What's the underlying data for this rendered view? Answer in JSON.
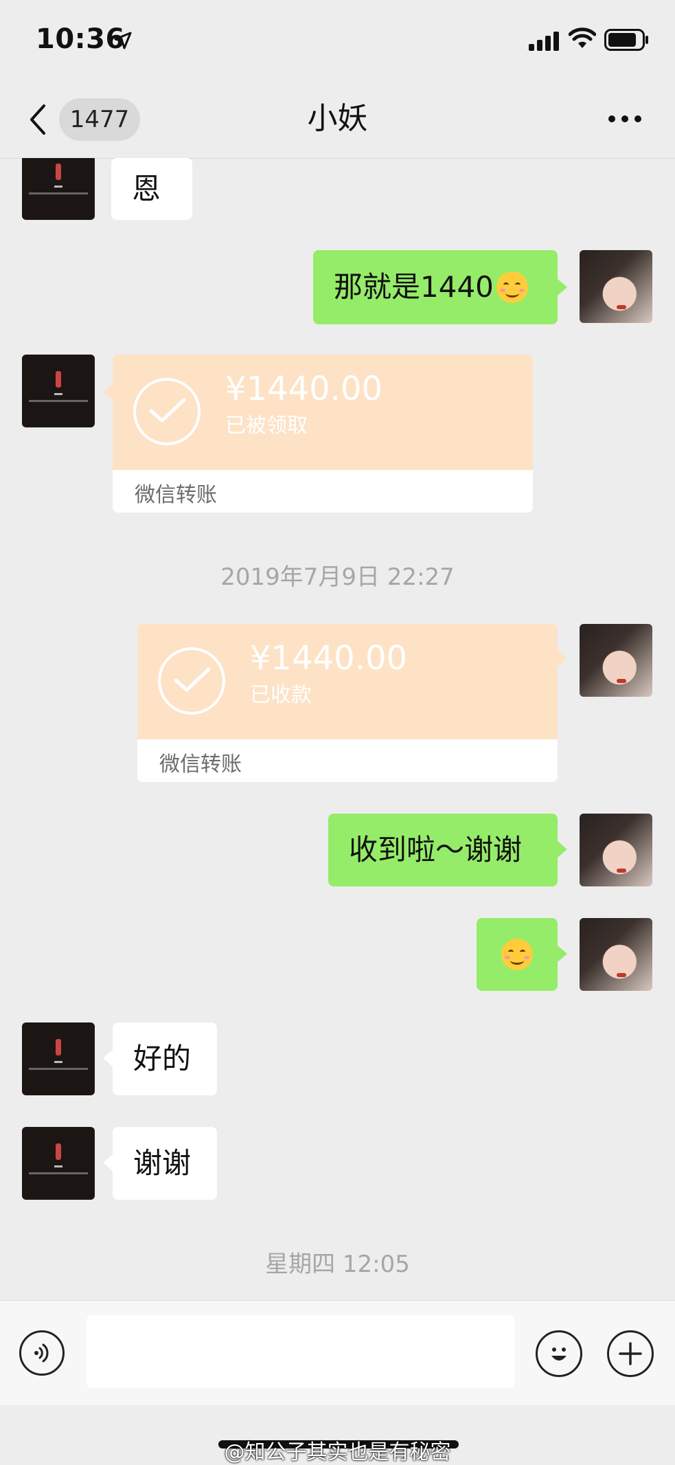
{
  "status_bar": {
    "time": "10:36"
  },
  "header": {
    "back_count": "1477",
    "title": "小妖"
  },
  "messages": [
    {
      "text": "恩"
    },
    {
      "text": "那就是1440"
    },
    {
      "amount": "¥1440.00",
      "status": "已被领取",
      "label": "微信转账"
    },
    {
      "amount": "¥1440.00",
      "status": "已收款",
      "label": "微信转账"
    },
    {
      "text": "收到啦～谢谢"
    },
    {
      "text": "好的"
    },
    {
      "text": "谢谢"
    }
  ],
  "timestamps": [
    "2019年7月9日 22:27",
    "星期四 12:05"
  ],
  "input_bar": {
    "placeholder": ""
  },
  "watermark": "@知公子其实也是有秘密",
  "icons": [
    "back-arrow-icon",
    "location-arrow-icon",
    "signal-icon",
    "wifi-icon",
    "battery-icon",
    "more-icon",
    "voice-icon",
    "emoji-icon",
    "plus-icon",
    "check-icon"
  ],
  "colors": {
    "background": "#ededed",
    "sent_bubble": "#95ec69",
    "received_bubble": "#ffffff",
    "transfer_card": "#fde2c6"
  }
}
